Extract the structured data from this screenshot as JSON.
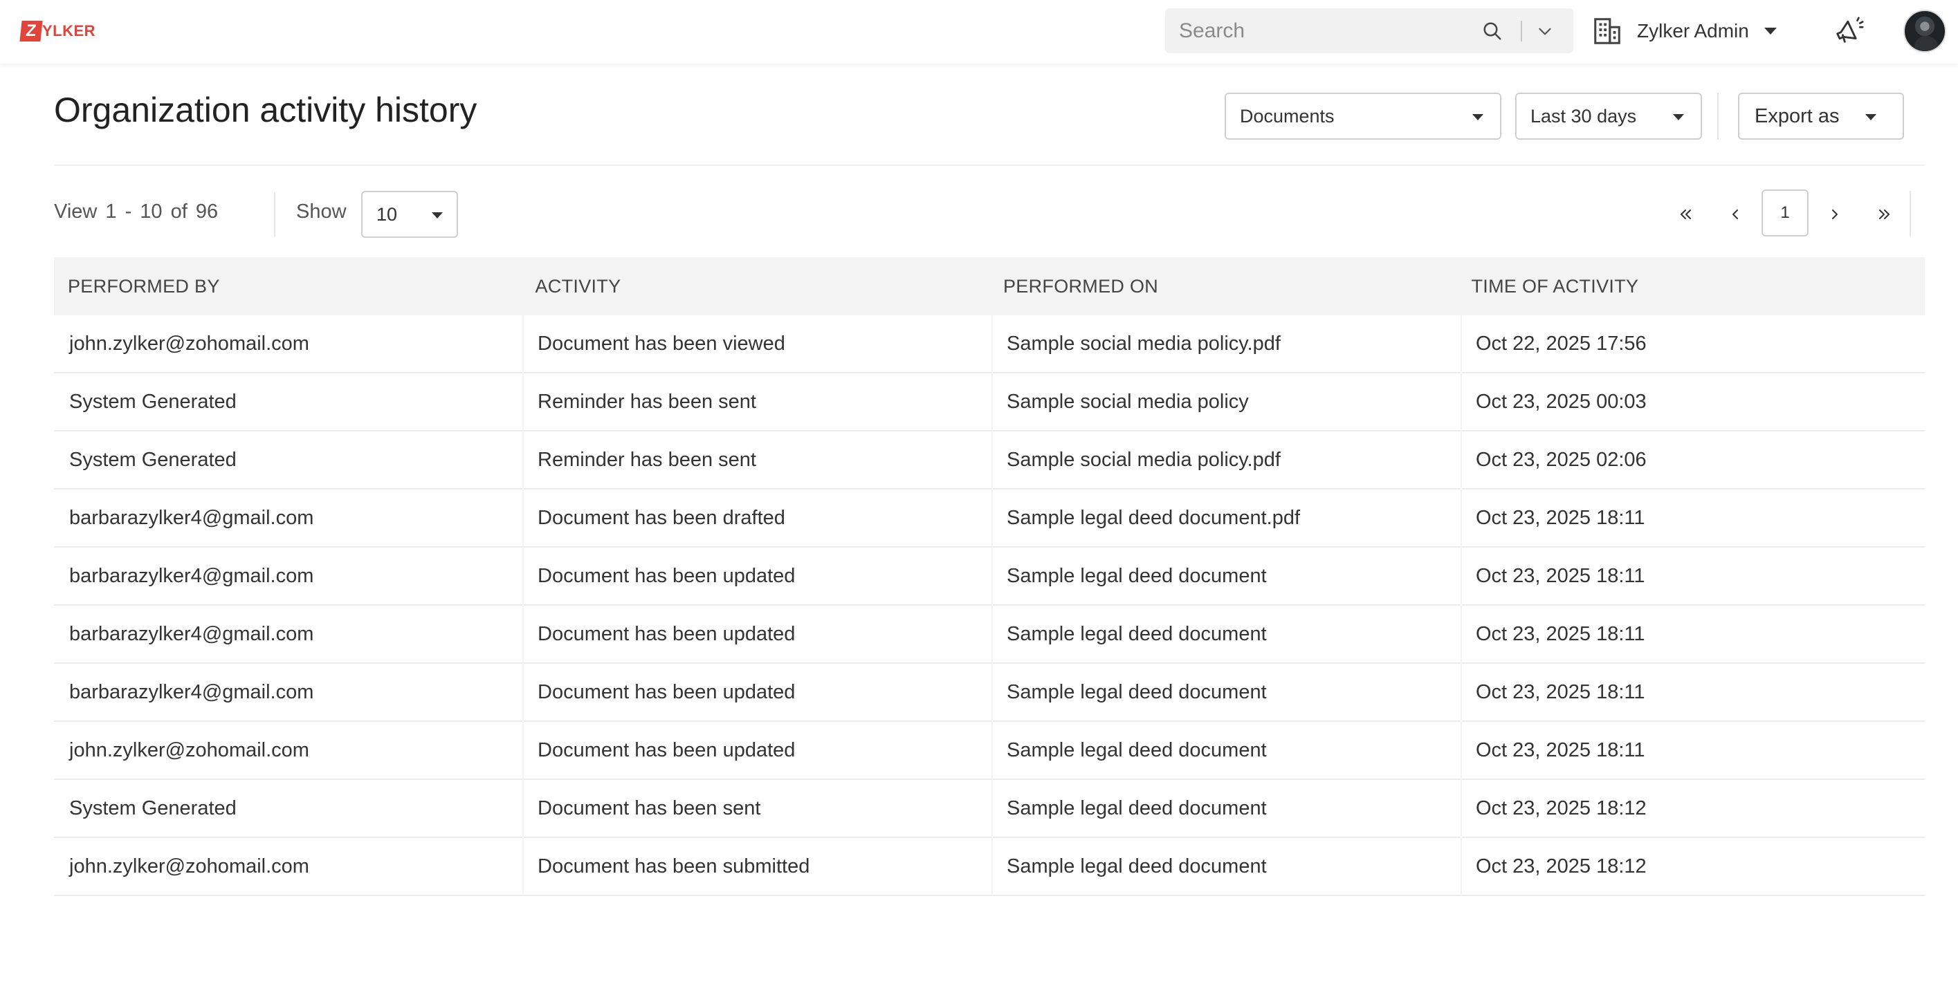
{
  "brand": {
    "logo_letter": "Z",
    "logo_text": "YLKER",
    "color": "#e0443b"
  },
  "topbar": {
    "search_placeholder": "Search",
    "org_name": "Zylker Admin"
  },
  "page": {
    "title": "Organization activity history",
    "filters": {
      "category": "Documents",
      "range": "Last 30 days",
      "export_label": "Export as"
    }
  },
  "pager": {
    "view_label": "View",
    "range_text": "1 - 10",
    "of_label": "of",
    "total": "96",
    "show_label": "Show",
    "page_size": "10",
    "current_page": "1"
  },
  "table": {
    "headers": [
      "PERFORMED BY",
      "ACTIVITY",
      "PERFORMED ON",
      "TIME OF ACTIVITY"
    ],
    "rows": [
      [
        "john.zylker@zohomail.com",
        "Document has been viewed",
        "Sample social media policy.pdf",
        "Oct 22, 2025 17:56"
      ],
      [
        "System Generated",
        "Reminder has been sent",
        "Sample social media policy",
        "Oct 23, 2025 00:03"
      ],
      [
        "System Generated",
        "Reminder has been sent",
        "Sample social media policy.pdf",
        "Oct 23, 2025 02:06"
      ],
      [
        "barbarazylker4@gmail.com",
        "Document has been drafted",
        "Sample legal deed document.pdf",
        "Oct 23, 2025 18:11"
      ],
      [
        "barbarazylker4@gmail.com",
        "Document has been updated",
        "Sample legal deed document",
        "Oct 23, 2025 18:11"
      ],
      [
        "barbarazylker4@gmail.com",
        "Document has been updated",
        "Sample legal deed document",
        "Oct 23, 2025 18:11"
      ],
      [
        "barbarazylker4@gmail.com",
        "Document has been updated",
        "Sample legal deed document",
        "Oct 23, 2025 18:11"
      ],
      [
        "john.zylker@zohomail.com",
        "Document has been updated",
        "Sample legal deed document",
        "Oct 23, 2025 18:11"
      ],
      [
        "System Generated",
        "Document has been sent",
        "Sample legal deed document",
        "Oct 23, 2025 18:12"
      ],
      [
        "john.zylker@zohomail.com",
        "Document has been submitted",
        "Sample legal deed document",
        "Oct 23, 2025 18:12"
      ]
    ]
  }
}
